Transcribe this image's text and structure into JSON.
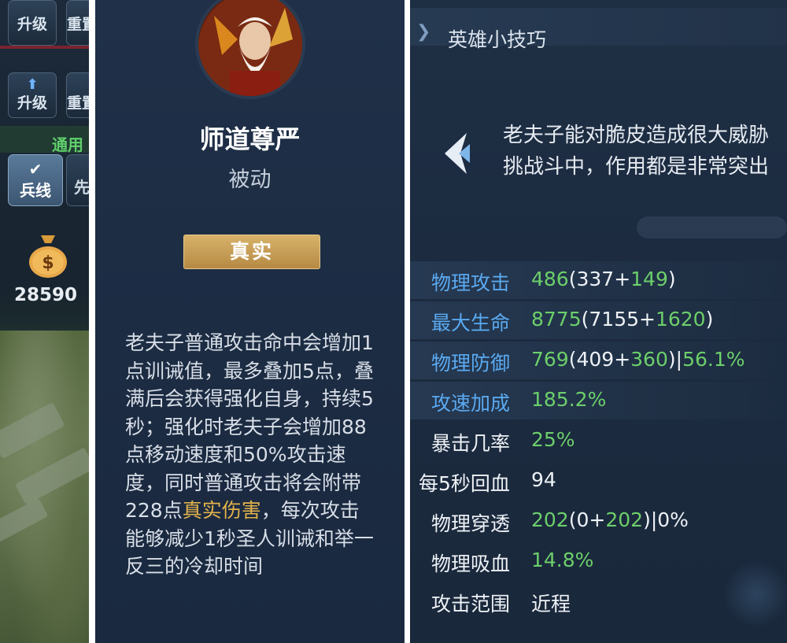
{
  "left": {
    "upgrade_label": "升级",
    "reset_label": "重置",
    "general_label": "通用",
    "minion_label": "兵线",
    "first_label": "先",
    "gold": "28590",
    "gold_icon": "money-bag-icon"
  },
  "skill": {
    "name": "师道尊严",
    "type": "被动",
    "damage_type": "真实",
    "desc_part1": "老夫子普通攻击命中会增加1点训诫值，最多叠加5点，叠满后会获得强化自身，持续5秒；强化时老夫子会增加88点移动速度和50%攻击速度，同时普通攻击将会附带228点",
    "desc_highlight": "真实伤害",
    "desc_part2": "，每次攻击能够减少1秒圣人训诫和举一反三的冷却时间",
    "highlight_color": "#e2b24a"
  },
  "tips": {
    "title": "英雄小技巧",
    "line1": "老夫子能对脆皮造成很大威胁",
    "line2": "挑战斗中，作用都是非常突出"
  },
  "stats": [
    {
      "label": "物理攻击",
      "base": "486",
      "parts": [
        "(",
        "337",
        "+",
        "149",
        ")"
      ]
    },
    {
      "label": "最大生命",
      "base": "8775",
      "parts": [
        "(",
        "7155",
        "+",
        "1620",
        ")"
      ]
    },
    {
      "label": "物理防御",
      "base": "769",
      "parts": [
        "(",
        "409",
        "+",
        "360",
        ")|",
        "56.1%"
      ]
    },
    {
      "label": "攻速加成",
      "base": "185.2%"
    },
    {
      "label": "暴击几率",
      "base": "25%"
    },
    {
      "label": "每5秒回血",
      "base": "94"
    },
    {
      "label": "物理穿透",
      "base": "202",
      "parts": [
        "(",
        "0",
        "+",
        "202",
        ")|0%"
      ]
    },
    {
      "label": "物理吸血",
      "base": "14.8%"
    },
    {
      "label": "攻击范围",
      "base": "近程"
    }
  ],
  "colors": {
    "stat_blue": "#5aa9f0",
    "stat_green": "#6ccf6a",
    "badge_gold": "#c99d55"
  }
}
